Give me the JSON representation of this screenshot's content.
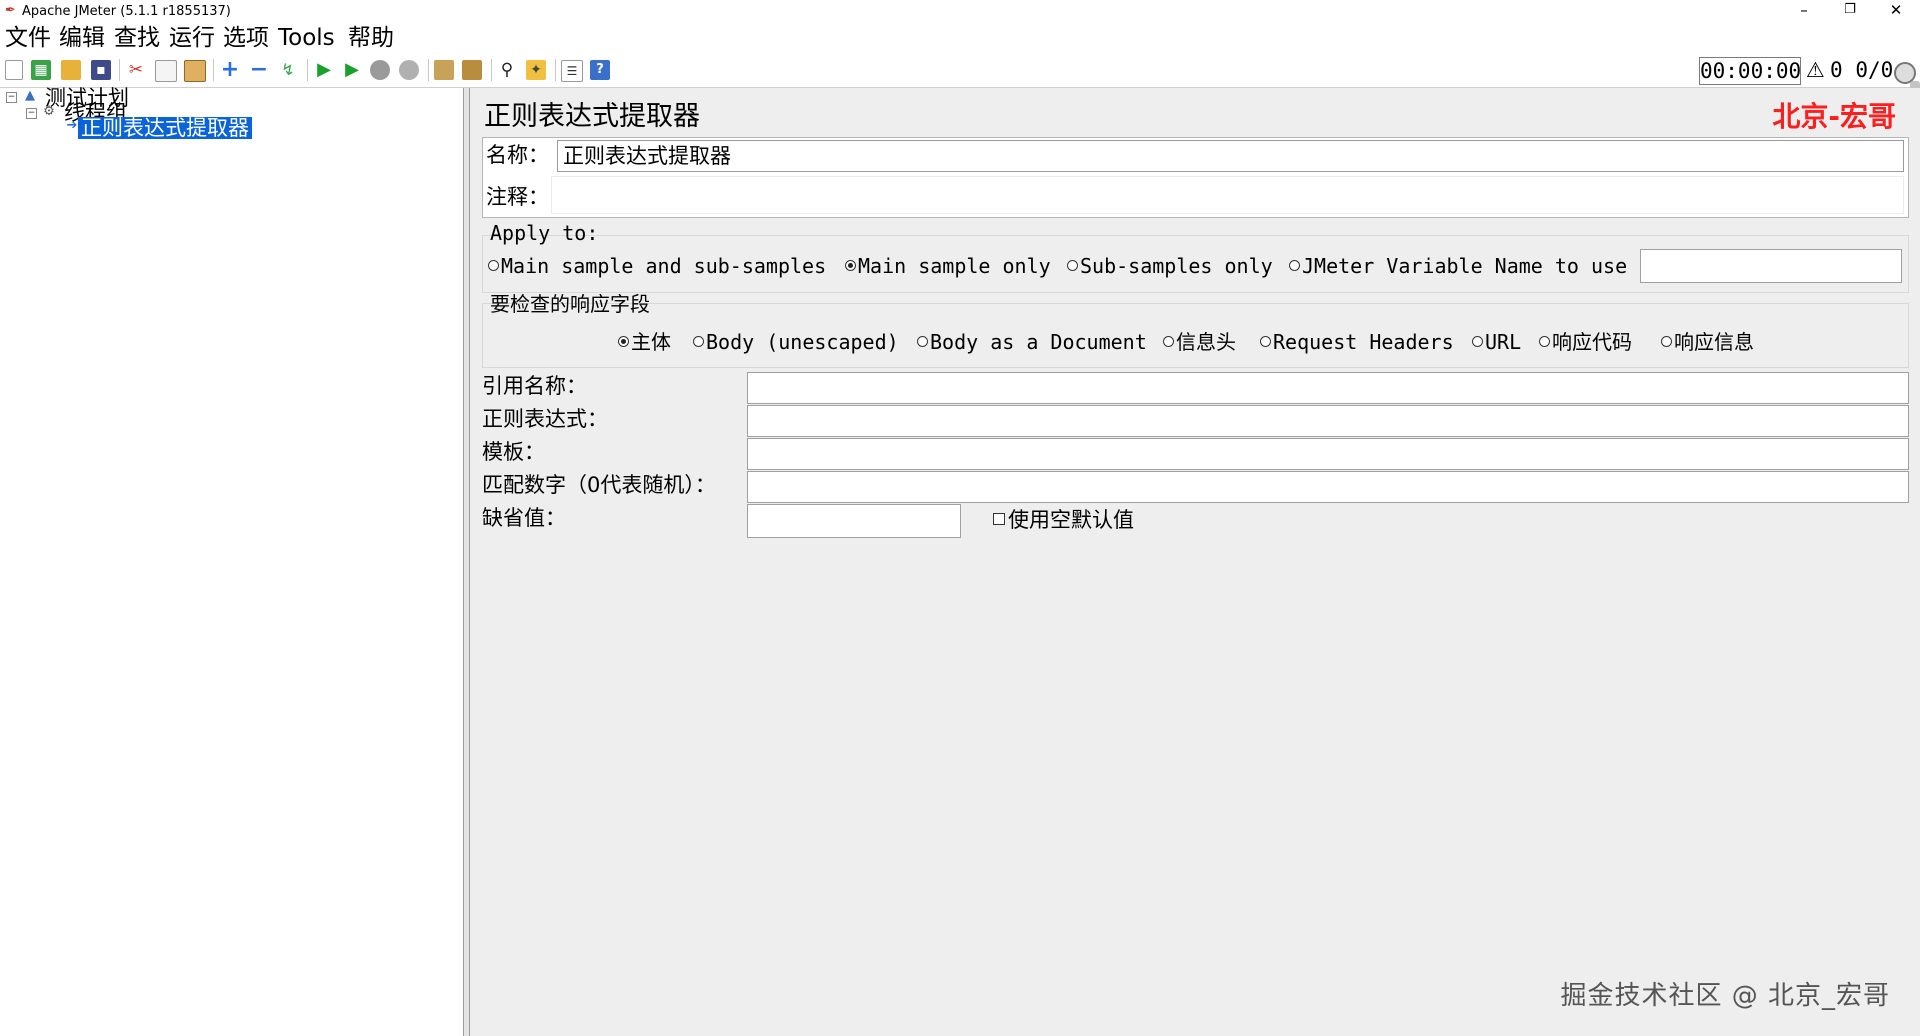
{
  "window": {
    "title": "Apache JMeter (5.1.1 r1855137)",
    "controls": {
      "minimize": "–",
      "restore": "❐",
      "close": "✕"
    }
  },
  "menu": {
    "items": [
      "文件",
      "编辑",
      "查找",
      "运行",
      "选项",
      "Tools",
      "帮助"
    ]
  },
  "toolbar": {
    "timer": "00:00:00",
    "warning_count": "0",
    "thread_counts": "0/0"
  },
  "tree": {
    "nodes": [
      {
        "label": "测试计划",
        "icon": "test-plan-icon"
      },
      {
        "label": "线程组",
        "icon": "thread-group-icon"
      },
      {
        "label": "正则表达式提取器",
        "icon": "post-processor-icon",
        "selected": true
      }
    ]
  },
  "editor": {
    "panel_title": "正则表达式提取器",
    "brand": "北京-宏哥",
    "name_label": "名称：",
    "name_value": "正则表达式提取器",
    "comment_label": "注释：",
    "comment_value": "",
    "apply_to": {
      "label": "Apply to:",
      "options": [
        {
          "label": "Main sample and sub-samples",
          "selected": false
        },
        {
          "label": "Main sample only",
          "selected": true
        },
        {
          "label": "Sub-samples only",
          "selected": false
        },
        {
          "label": "JMeter Variable Name to use",
          "selected": false
        }
      ],
      "variable_name_value": ""
    },
    "response_field": {
      "label": "要检查的响应字段",
      "options": [
        {
          "label": "主体",
          "selected": true
        },
        {
          "label": "Body (unescaped)",
          "selected": false
        },
        {
          "label": "Body as a Document",
          "selected": false
        },
        {
          "label": "信息头",
          "selected": false
        },
        {
          "label": "Request Headers",
          "selected": false
        },
        {
          "label": "URL",
          "selected": false
        },
        {
          "label": "响应代码",
          "selected": false
        },
        {
          "label": "响应信息",
          "selected": false
        }
      ]
    },
    "fields": [
      {
        "label": "引用名称：",
        "value": ""
      },
      {
        "label": "正则表达式：",
        "value": ""
      },
      {
        "label": "模板：",
        "value": ""
      },
      {
        "label": "匹配数字（0代表随机）：",
        "value": ""
      }
    ],
    "default_value": {
      "label": "缺省值：",
      "value": "",
      "use_empty_label": "使用空默认值",
      "use_empty_checked": false
    }
  },
  "watermark": "掘金技术社区 @ 北京_宏哥"
}
